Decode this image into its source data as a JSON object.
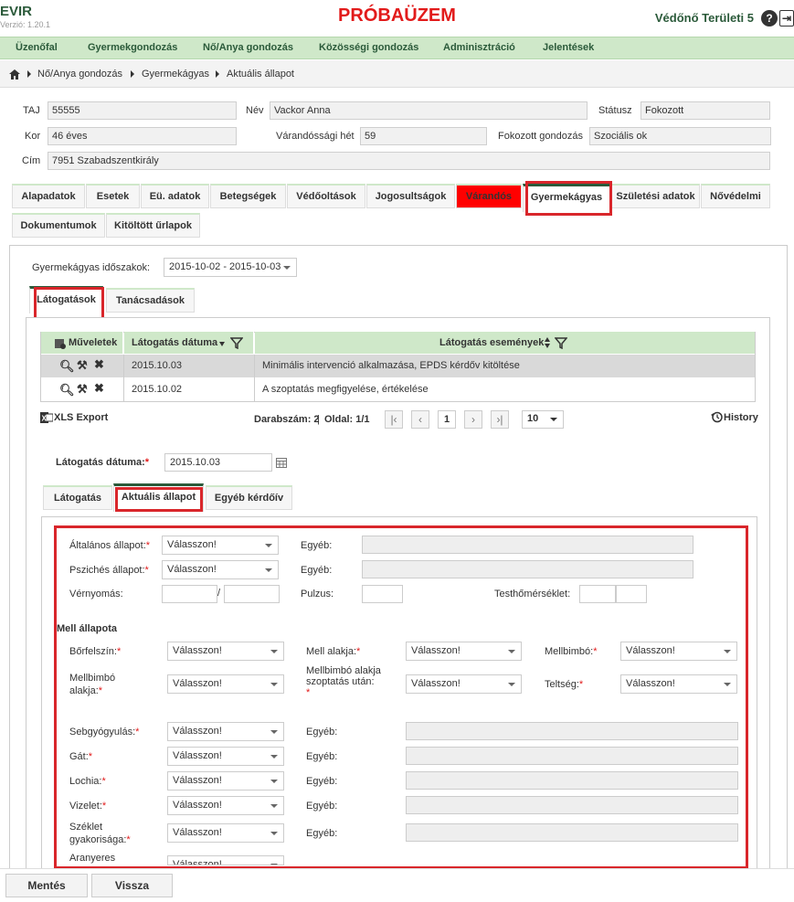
{
  "header": {
    "app_name": "EVIR",
    "version": "Verzió: 1.20.1",
    "test_banner": "PRÓBAÜZEM",
    "user": "Védőnő Területi 5",
    "help_label": "?",
    "logout_label": "⇥"
  },
  "nav": [
    "Üzenőfal",
    "Gyermekgondozás",
    "Nő/Anya gondozás",
    "Közösségi gondozás",
    "Adminisztráció",
    "Jelentések"
  ],
  "breadcrumb": [
    "Nő/Anya gondozás",
    "Gyermekágyas",
    "Aktuális állapot"
  ],
  "patient": {
    "taj_label": "TAJ",
    "taj": "55555",
    "nev_label": "Név",
    "nev": "Vackor Anna",
    "status_label": "Státusz",
    "status": "Fokozott",
    "kor_label": "Kor",
    "kor": "46 éves",
    "varandossagi_het_label": "Várandóssági hét",
    "varandossagi_het": "59",
    "fokozott_label": "Fokozott gondozás",
    "fokozott": "Szociális ok",
    "cim_label": "Cím",
    "cim": "7951 Szabadszentkirály"
  },
  "tabs": [
    "Alapadatok",
    "Esetek",
    "Eü. adatok",
    "Betegségek",
    "Védőoltások",
    "Jogosultságok",
    "Várandós",
    "Gyermekágyas",
    "Születési adatok",
    "Nővédelmi",
    "Dokumentumok",
    "Kitöltött űrlapok"
  ],
  "periods": {
    "label": "Gyermekágyas időszakok:",
    "value": "2015-10-02 - 2015-10-03"
  },
  "subtabs": [
    "Látogatások",
    "Tanácsadások"
  ],
  "table": {
    "headers": [
      "Műveletek",
      "Látogatás dátuma",
      "Látogatás események"
    ],
    "rows": [
      {
        "date": "2015.10.03",
        "event": "Minimális intervenció alkalmazása, EPDS kérdőv kitöltése"
      },
      {
        "date": "2015.10.02",
        "event": "A szoptatás megfigyelése, értékelése"
      }
    ]
  },
  "footer_bar": {
    "xls": "XLS Export",
    "count": "Darabszám: 2",
    "sep": "|",
    "page": "Oldal: 1/1",
    "current_page": "1",
    "page_size": "10",
    "history": "History"
  },
  "visit": {
    "label": "Látogatás dátuma:",
    "value": "2015.10.03"
  },
  "visit_tabs": [
    "Látogatás",
    "Aktuális állapot",
    "Egyéb kérdőív"
  ],
  "form": {
    "altalanos": "Általános állapot:",
    "pszich": "Pszichés állapot:",
    "vernyomas": "Vérnyomás:",
    "pulzus": "Pulzus:",
    "testho": "Testhőmérséklet:",
    "egyeb": "Egyéb:",
    "valasszon": "Válasszon!",
    "slash": "/",
    "mell_title": "Mell állapota",
    "borfelszin": "Bőrfelszín:",
    "mell_alakja": "Mell alakja:",
    "mellbimbo": "Mellbimbó:",
    "mellbimbo_alakja_1": "Mellbimbó",
    "mellbimbo_alakja_2": "alakja:",
    "mellbimbo_utan_1": "Mellbimbó alakja",
    "mellbimbo_utan_2": "szoptatás után:",
    "teltseg": "Teltség:",
    "sebgyogyulas": "Sebgyógyulás:",
    "gat": "Gát:",
    "lochia": "Lochia:",
    "vizelet": "Vizelet:",
    "szeklet_1": "Széklet",
    "szeklet_2": "gyakorisága:",
    "aranyeres": "Aranyeres",
    "req": "*"
  },
  "buttons": {
    "save": "Mentés",
    "back": "Vissza"
  },
  "colors": {
    "nav_bg": "#cfe8c9",
    "brand": "#2b5a3a",
    "highlight": "#d9262b",
    "banner": "#e21b1b"
  }
}
